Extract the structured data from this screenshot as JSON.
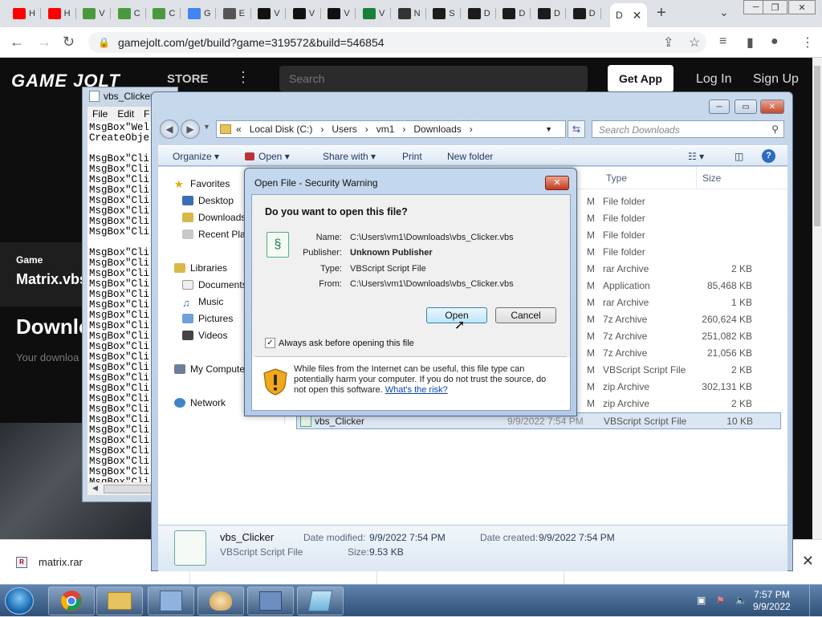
{
  "browser": {
    "tabs": [
      {
        "label": "H",
        "icon": "youtube-icon",
        "color": "#ff0000"
      },
      {
        "label": "H",
        "icon": "youtube-icon",
        "color": "#ff0000"
      },
      {
        "label": "V",
        "icon": "mosaic-icon",
        "color": "#4a9a3d"
      },
      {
        "label": "C",
        "icon": "mosaic-icon",
        "color": "#4a9a3d"
      },
      {
        "label": "C",
        "icon": "mosaic-icon",
        "color": "#4a9a3d"
      },
      {
        "label": "G",
        "icon": "google-icon",
        "color": "#4285f4"
      },
      {
        "label": "E",
        "icon": "globe-icon",
        "color": "#555555"
      },
      {
        "label": "V",
        "icon": "w-logo-icon",
        "color": "#111111"
      },
      {
        "label": "V",
        "icon": "w-logo-icon",
        "color": "#111111"
      },
      {
        "label": "V",
        "icon": "w-logo-icon",
        "color": "#111111"
      },
      {
        "label": "V",
        "icon": "sheet-icon",
        "color": "#188038"
      },
      {
        "label": "N",
        "icon": "museum-icon",
        "color": "#333333"
      },
      {
        "label": "S",
        "icon": "lightning-icon",
        "color": "#1b1b1b"
      },
      {
        "label": "D",
        "icon": "lightning-icon",
        "color": "#1b1b1b"
      },
      {
        "label": "D",
        "icon": "lightning-icon",
        "color": "#1b1b1b"
      },
      {
        "label": "D",
        "icon": "lightning-icon",
        "color": "#1b1b1b"
      },
      {
        "label": "D",
        "icon": "lightning-icon",
        "color": "#1b1b1b"
      }
    ],
    "active_tab_label": "D",
    "url": "gamejolt.com/get/build?game=319572&build=546854"
  },
  "gamejolt": {
    "logo": "GAME JOLT",
    "store": "STORE",
    "search_placeholder": "Search",
    "get_app": "Get App",
    "login": "Log In",
    "signup": "Sign Up",
    "game_label": "Game",
    "game_name": "Matrix.vbs",
    "download_heading": "Downlo",
    "download_sub": "Your downloa"
  },
  "download_bar": {
    "file": "matrix.rar"
  },
  "notepad": {
    "title": "vbs_Clicker",
    "menu": [
      "File",
      "Edit",
      "F"
    ],
    "lines": [
      "MsgBox\"Wel",
      "CreateObje",
      "",
      "MsgBox\"Cli",
      "MsgBox\"Cli",
      "MsgBox\"Cli",
      "MsgBox\"Cli",
      "MsgBox\"Cli",
      "MsgBox\"Cli",
      "MsgBox\"Cli",
      "MsgBox\"Cli",
      "",
      "MsgBox\"Cli",
      "MsgBox\"Cli",
      "MsgBox\"Cli",
      "MsgBox\"Cli",
      "MsgBox\"Cli",
      "MsgBox\"Cli",
      "MsgBox\"Cli",
      "MsgBox\"Cli",
      "MsgBox\"Cli",
      "MsgBox\"Cli",
      "MsgBox\"Cli",
      "MsgBox\"Cli",
      "MsgBox\"Cli",
      "MsgBox\"Cli",
      "MsgBox\"Cli",
      "MsgBox\"Cli",
      "MsgBox\"Cli",
      "MsgBox\"Cli",
      "MsgBox\"Cli",
      "MsgBox\"Cli",
      "MsgBox\"Cli",
      "MsgBox\"Cli",
      "MsgBox\"Cli"
    ]
  },
  "explorer": {
    "address": [
      "«",
      "Local Disk (C:)",
      "›",
      "Users",
      "›",
      "vm1",
      "›",
      "Downloads",
      "›"
    ],
    "search_placeholder": "Search Downloads",
    "commands": {
      "organize": "Organize ▾",
      "open": "Open ▾",
      "share": "Share with ▾",
      "print": "Print",
      "new_folder": "New folder"
    },
    "nav": {
      "favorites": "Favorites",
      "desktop": "Desktop",
      "downloads": "Downloads",
      "recent": "Recent Plac",
      "libraries": "Libraries",
      "documents": "Documents",
      "music": "Music",
      "pictures": "Pictures",
      "videos": "Videos",
      "computer": "My Compute",
      "network": "Network"
    },
    "columns": {
      "type": "Type",
      "size": "Size"
    },
    "rows": [
      {
        "mark": "M",
        "type": "File folder",
        "size": ""
      },
      {
        "mark": "M",
        "type": "File folder",
        "size": ""
      },
      {
        "mark": "M",
        "type": "File folder",
        "size": ""
      },
      {
        "mark": "M",
        "type": "File folder",
        "size": ""
      },
      {
        "mark": "M",
        "type": "rar Archive",
        "size": "2 KB"
      },
      {
        "mark": "M",
        "type": "Application",
        "size": "85,468 KB"
      },
      {
        "mark": "M",
        "type": "rar Archive",
        "size": "1 KB"
      },
      {
        "mark": "M",
        "type": "7z Archive",
        "size": "260,624 KB"
      },
      {
        "mark": "M",
        "type": "7z Archive",
        "size": "251,082 KB"
      },
      {
        "mark": "M",
        "type": "7z Archive",
        "size": "21,056 KB"
      },
      {
        "mark": "M",
        "type": "VBScript Script File",
        "size": "2 KB"
      },
      {
        "mark": "M",
        "type": "zip Archive",
        "size": "302,131 KB"
      },
      {
        "mark": "M",
        "type": "zip Archive",
        "size": "2 KB"
      }
    ],
    "selected_row": {
      "name": "vbs_Clicker",
      "date": "9/9/2022 7:54 PM",
      "type": "VBScript Script File",
      "size": "10 KB"
    },
    "details": {
      "name": "vbs_Clicker",
      "type": "VBScript Script File",
      "modified_label": "Date modified:",
      "modified": "9/9/2022 7:54 PM",
      "created_label": "Date created:",
      "created": "9/9/2022 7:54 PM",
      "size_label": "Size:",
      "size": "9.53 KB"
    }
  },
  "dialog": {
    "title": "Open File - Security Warning",
    "question": "Do you want to open this file?",
    "labels": {
      "name": "Name:",
      "publisher": "Publisher:",
      "type": "Type:",
      "from": "From:"
    },
    "values": {
      "name": "C:\\Users\\vm1\\Downloads\\vbs_Clicker.vbs",
      "publisher": "Unknown Publisher",
      "type": "VBScript Script File",
      "from": "C:\\Users\\vm1\\Downloads\\vbs_Clicker.vbs"
    },
    "open": "Open",
    "cancel": "Cancel",
    "always_ask": "Always ask before opening this file",
    "warning": "While files from the Internet can be useful, this file type can potentially harm your computer. If you do not trust the source, do not open this software.",
    "risk_link": "What's the risk?"
  },
  "taskbar": {
    "time": "7:57 PM",
    "date": "9/9/2022"
  }
}
